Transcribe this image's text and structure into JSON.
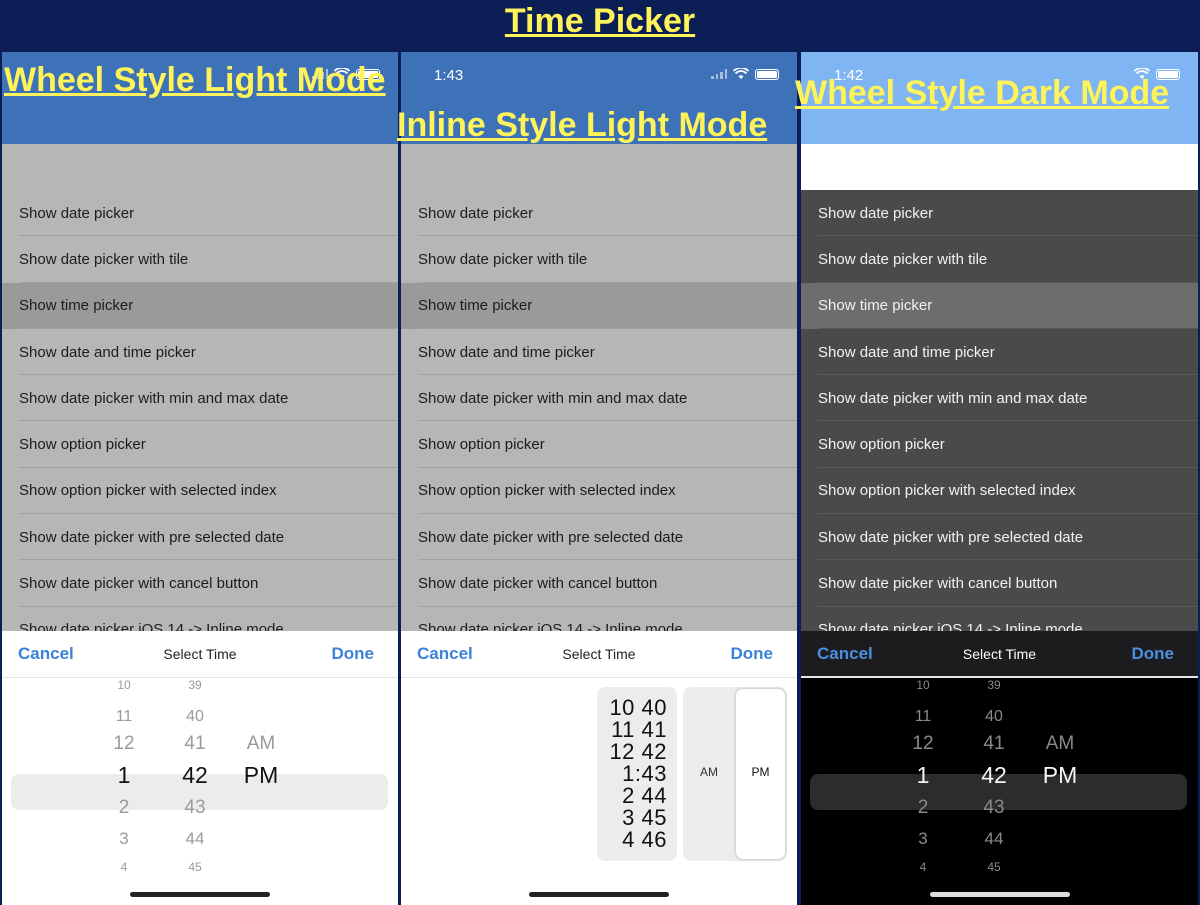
{
  "title": "Time Picker",
  "labels": {
    "wheel_light": "Wheel Style Light Mode",
    "inline_light": "Inline Style Light Mode",
    "wheel_dark": "Wheel Style Dark Mode"
  },
  "status": {
    "clock_inline": "1:43",
    "clock_dark": "1:42"
  },
  "menu_items": [
    "Show date picker",
    "Show date picker with tile",
    "Show time picker",
    "Show date and time picker",
    "Show date picker with min and max date",
    "Show option picker",
    "Show option picker with selected index",
    "Show date picker with pre selected date",
    "Show date picker with cancel button",
    "Show date picker iOS 14 -> Inline mode"
  ],
  "selected_item": "Show time picker",
  "toolbar": {
    "cancel": "Cancel",
    "title": "Select Time",
    "done": "Done"
  },
  "wheel": {
    "hours": [
      "10",
      "11",
      "12",
      "1",
      "2",
      "3",
      "4"
    ],
    "minutes": [
      "39",
      "40",
      "41",
      "42",
      "43",
      "44",
      "45"
    ],
    "ampm": [
      "AM",
      "PM"
    ],
    "selected": {
      "hour": "1",
      "minute": "42",
      "period": "PM"
    }
  },
  "inline": {
    "lines": [
      "10 40",
      "11 41",
      "12 42",
      "1:43",
      "2 44",
      "3 45",
      "4 46"
    ],
    "am": "AM",
    "pm": "PM",
    "selected_period": "PM"
  }
}
